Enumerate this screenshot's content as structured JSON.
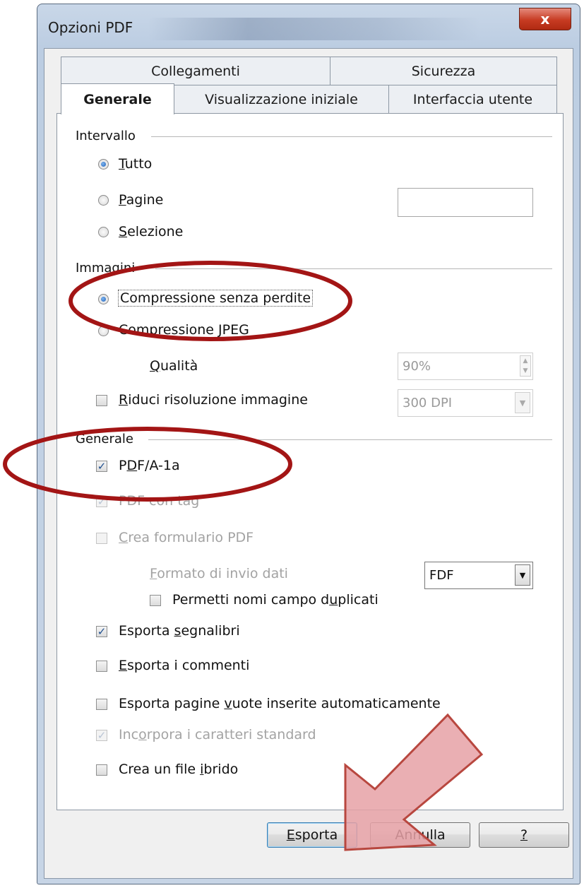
{
  "window": {
    "title": "Opzioni PDF",
    "close_glyph": "x"
  },
  "tabs": {
    "row1": [
      {
        "label": "Collegamenti"
      },
      {
        "label": "Sicurezza"
      }
    ],
    "row2": [
      {
        "label": "Generale"
      },
      {
        "label": "Visualizzazione iniziale"
      },
      {
        "label": "Interfaccia utente"
      }
    ],
    "active": "Generale"
  },
  "sections": {
    "intervallo": {
      "title": "Intervallo",
      "tutto": {
        "u": "T",
        "rest": "utto",
        "checked": true
      },
      "pagine": {
        "u": "P",
        "rest": "agine",
        "checked": false,
        "value": ""
      },
      "selezione": {
        "u": "S",
        "rest": "elezione",
        "checked": false
      }
    },
    "immagini": {
      "title": "Immagini",
      "lossless": {
        "label": "Compressione senza perdite",
        "checked": true
      },
      "jpeg": {
        "pre": "Compressione ",
        "u": "J",
        "rest": "PEG",
        "checked": false
      },
      "qualita": {
        "u": "Q",
        "rest": "ualità",
        "value": "90%"
      },
      "riduci": {
        "u": "R",
        "rest": "iduci risoluzione immagine",
        "checked": false,
        "dpi": "300 DPI"
      }
    },
    "generale": {
      "title": "Generale",
      "pdfa": {
        "pre": "P",
        "u": "D",
        "rest": "F/A-1a",
        "checked": true
      },
      "tag": {
        "label": "PDF con tag",
        "checked": true,
        "enabled": false
      },
      "formulario": {
        "u": "C",
        "rest": "rea formulario PDF",
        "checked": false,
        "enabled": false
      },
      "formato": {
        "u": "F",
        "rest": "ormato di invio dati",
        "value": "FDF"
      },
      "duplicati": {
        "pre": "Permetti nomi campo d",
        "u": "u",
        "rest": "plicati",
        "checked": false
      },
      "segnalibri": {
        "pre": "Esporta ",
        "u": "s",
        "rest": "egnalibri",
        "checked": true
      },
      "commenti": {
        "u": "E",
        "rest": "sporta i commenti",
        "checked": false
      },
      "vuote": {
        "pre": "Esporta pagine ",
        "u": "v",
        "rest": "uote inserite automaticamente",
        "checked": false
      },
      "incorpora": {
        "pre": "Inc",
        "u": "o",
        "rest": "rpora i caratteri standard",
        "checked": true,
        "enabled": false
      },
      "ibrido": {
        "pre": "Crea un file ",
        "u": "i",
        "rest": "brido",
        "checked": false
      }
    }
  },
  "buttons": {
    "esporta": {
      "u": "E",
      "rest": "sporta"
    },
    "annulla": {
      "label": "Annulla"
    },
    "help": {
      "label": "?"
    }
  },
  "annotations": {
    "circle_color": "#a31515",
    "arrow_fill": "#e6a1a6",
    "arrow_stroke": "#b8473f"
  }
}
